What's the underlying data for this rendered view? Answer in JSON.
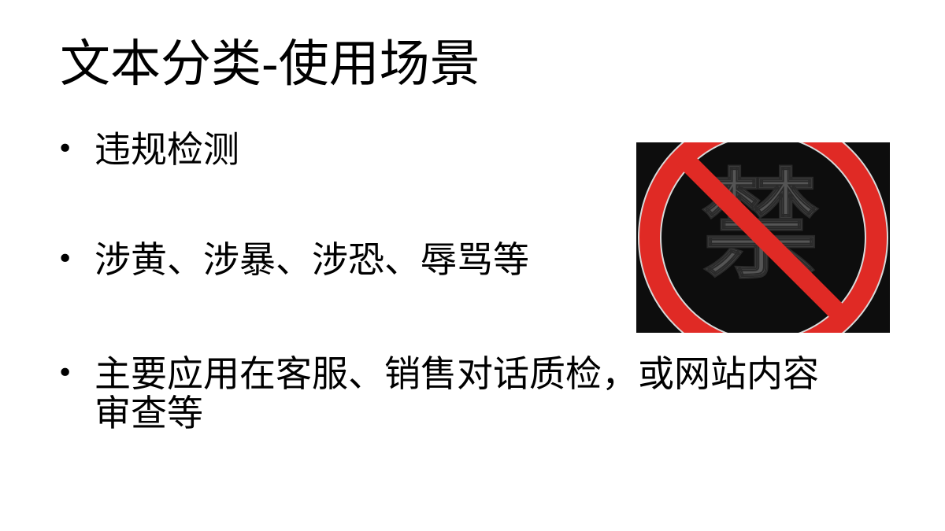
{
  "slide": {
    "title": "文本分类-使用场景",
    "bullets": [
      "违规检测",
      "涉黄、涉暴、涉恐、辱骂等",
      "主要应用在客服、销售对话质检，或网站内容审查等"
    ],
    "bullet_symbol": "•"
  },
  "image": {
    "character": "禁",
    "icon": "prohibited-sign-icon",
    "colors": {
      "background": "#0d0d0d",
      "ring": "#e02a25",
      "character": "#555555"
    }
  }
}
